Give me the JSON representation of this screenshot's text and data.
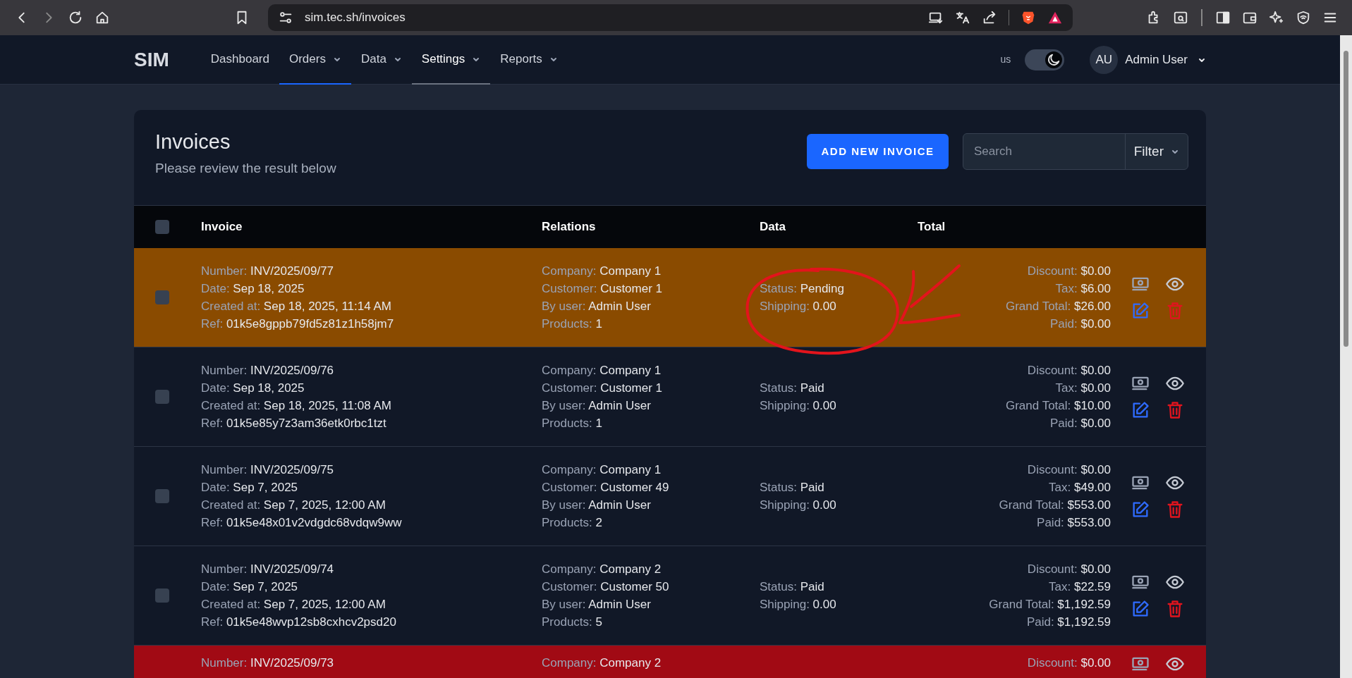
{
  "browser": {
    "url": "sim.tec.sh/invoices"
  },
  "navbar": {
    "brand": "SIM",
    "items": [
      {
        "label": "Dashboard",
        "dropdown": false,
        "selected": false,
        "hovered": false
      },
      {
        "label": "Orders",
        "dropdown": true,
        "selected": true,
        "hovered": false
      },
      {
        "label": "Data",
        "dropdown": true,
        "selected": false,
        "hovered": false
      },
      {
        "label": "Settings",
        "dropdown": true,
        "selected": false,
        "hovered": true
      },
      {
        "label": "Reports",
        "dropdown": true,
        "selected": false,
        "hovered": false
      }
    ],
    "locale": "us",
    "dark_mode": true,
    "user": {
      "initials": "AU",
      "name": "Admin User"
    }
  },
  "page": {
    "title": "Invoices",
    "subtitle": "Please review the result below",
    "add_button": "ADD NEW INVOICE",
    "search": {
      "placeholder": "Search"
    },
    "filter": "Filter"
  },
  "table": {
    "select_all_checked": false,
    "columns": [
      "Invoice",
      "Relations",
      "Data",
      "Total"
    ],
    "rows": [
      {
        "color": "#8a4b00",
        "checked": false,
        "invoice": [
          {
            "label": "Number:",
            "value": "INV/2025/09/77"
          },
          {
            "label": "Date:",
            "value": "Sep 18, 2025"
          },
          {
            "label": "Created at:",
            "value": "Sep 18, 2025, 11:14 AM"
          },
          {
            "label": "Ref:",
            "value": "01k5e8gppb79fd5z81z1h58jm7"
          }
        ],
        "relations": [
          {
            "label": "Company:",
            "value": "Company 1"
          },
          {
            "label": "Customer:",
            "value": "Customer 1"
          },
          {
            "label": "By user:",
            "value": "Admin User"
          },
          {
            "label": "Products:",
            "value": "1"
          }
        ],
        "data": [
          {
            "label": "Status:",
            "value": "Pending"
          },
          {
            "label": "Shipping:",
            "value": "0.00"
          }
        ],
        "totals": [
          {
            "label": "Discount:",
            "value": "$0.00"
          },
          {
            "label": "Tax:",
            "value": "$6.00"
          },
          {
            "label": "Grand Total:",
            "value": "$26.00"
          },
          {
            "label": "Paid:",
            "value": "$0.00"
          }
        ]
      },
      {
        "color": "#111827",
        "checked": false,
        "invoice": [
          {
            "label": "Number:",
            "value": "INV/2025/09/76"
          },
          {
            "label": "Date:",
            "value": "Sep 18, 2025"
          },
          {
            "label": "Created at:",
            "value": "Sep 18, 2025, 11:08 AM"
          },
          {
            "label": "Ref:",
            "value": "01k5e85y7z3am36etk0rbc1tzt"
          }
        ],
        "relations": [
          {
            "label": "Company:",
            "value": "Company 1"
          },
          {
            "label": "Customer:",
            "value": "Customer 1"
          },
          {
            "label": "By user:",
            "value": "Admin User"
          },
          {
            "label": "Products:",
            "value": "1"
          }
        ],
        "data": [
          {
            "label": "Status:",
            "value": "Paid"
          },
          {
            "label": "Shipping:",
            "value": "0.00"
          }
        ],
        "totals": [
          {
            "label": "Discount:",
            "value": "$0.00"
          },
          {
            "label": "Tax:",
            "value": "$0.00"
          },
          {
            "label": "Grand Total:",
            "value": "$10.00"
          },
          {
            "label": "Paid:",
            "value": "$0.00"
          }
        ]
      },
      {
        "color": "#111827",
        "checked": false,
        "invoice": [
          {
            "label": "Number:",
            "value": "INV/2025/09/75"
          },
          {
            "label": "Date:",
            "value": "Sep 7, 2025"
          },
          {
            "label": "Created at:",
            "value": "Sep 7, 2025, 12:00 AM"
          },
          {
            "label": "Ref:",
            "value": "01k5e48x01v2vdgdc68vdqw9ww"
          }
        ],
        "relations": [
          {
            "label": "Company:",
            "value": "Company 1"
          },
          {
            "label": "Customer:",
            "value": "Customer 49"
          },
          {
            "label": "By user:",
            "value": "Admin User"
          },
          {
            "label": "Products:",
            "value": "2"
          }
        ],
        "data": [
          {
            "label": "Status:",
            "value": "Paid"
          },
          {
            "label": "Shipping:",
            "value": "0.00"
          }
        ],
        "totals": [
          {
            "label": "Discount:",
            "value": "$0.00"
          },
          {
            "label": "Tax:",
            "value": "$49.00"
          },
          {
            "label": "Grand Total:",
            "value": "$553.00"
          },
          {
            "label": "Paid:",
            "value": "$553.00"
          }
        ]
      },
      {
        "color": "#111827",
        "checked": false,
        "invoice": [
          {
            "label": "Number:",
            "value": "INV/2025/09/74"
          },
          {
            "label": "Date:",
            "value": "Sep 7, 2025"
          },
          {
            "label": "Created at:",
            "value": "Sep 7, 2025, 12:00 AM"
          },
          {
            "label": "Ref:",
            "value": "01k5e48wvp12sb8cxhcv2psd20"
          }
        ],
        "relations": [
          {
            "label": "Company:",
            "value": "Company 2"
          },
          {
            "label": "Customer:",
            "value": "Customer 50"
          },
          {
            "label": "By user:",
            "value": "Admin User"
          },
          {
            "label": "Products:",
            "value": "5"
          }
        ],
        "data": [
          {
            "label": "Status:",
            "value": "Paid"
          },
          {
            "label": "Shipping:",
            "value": "0.00"
          }
        ],
        "totals": [
          {
            "label": "Discount:",
            "value": "$0.00"
          },
          {
            "label": "Tax:",
            "value": "$22.59"
          },
          {
            "label": "Grand Total:",
            "value": "$1,192.59"
          },
          {
            "label": "Paid:",
            "value": "$1,192.59"
          }
        ]
      },
      {
        "color": "#a10a14",
        "invoice": [
          {
            "label": "Number:",
            "value": "INV/2025/09/73"
          }
        ],
        "relations": [
          {
            "label": "Company:",
            "value": "Company 2"
          }
        ],
        "data": [],
        "totals": [
          {
            "label": "Discount:",
            "value": "$0.00"
          }
        ]
      }
    ]
  }
}
